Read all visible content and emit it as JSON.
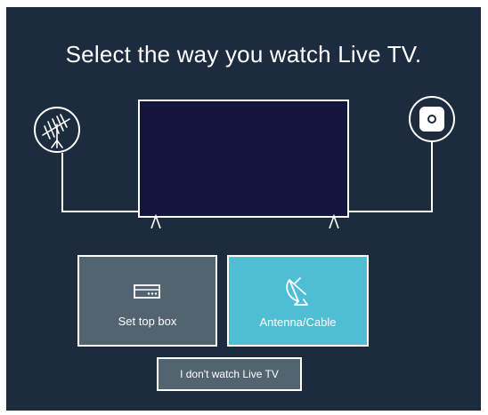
{
  "screen": {
    "title": "Select the way you watch Live TV."
  },
  "illustration": {
    "left_icon": "antenna-icon",
    "right_icon": "set-top-box-icon",
    "center": "tv-icon"
  },
  "options": [
    {
      "label": "Set top box",
      "icon": "set-top-box-icon",
      "selected": false,
      "color": "#536471"
    },
    {
      "label": "Antenna/Cable",
      "icon": "satellite-dish-icon",
      "selected": true,
      "color": "#4fbdd4"
    }
  ],
  "secondary_button": {
    "label": "I don't watch Live TV"
  },
  "colors": {
    "background": "#1d2b3e",
    "tv_screen": "#12163f",
    "card": "#536471",
    "selected_card": "#4fbdd4"
  }
}
